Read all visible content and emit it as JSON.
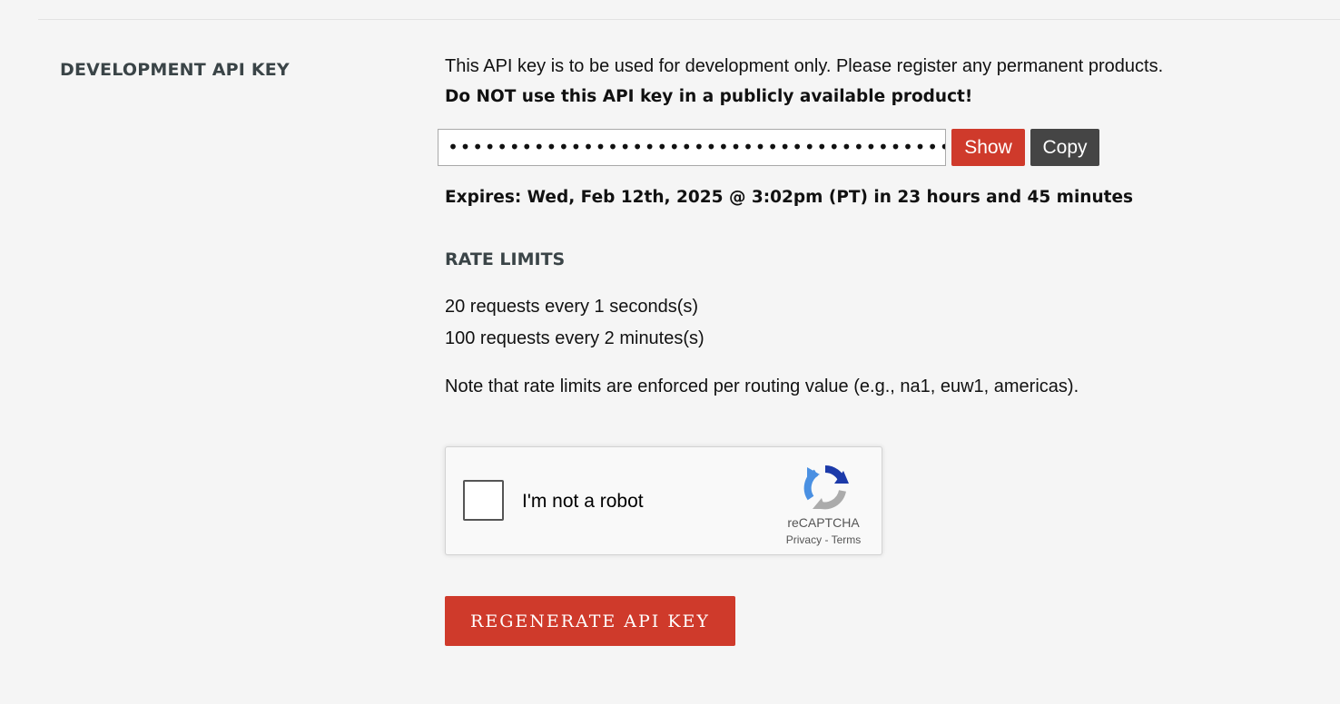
{
  "section": {
    "label": "DEVELOPMENT API KEY"
  },
  "api_key": {
    "description": "This API key is to be used for development only. Please register any permanent products.",
    "warning": "Do NOT use this API key in a publicly available product!",
    "masked_value": "••••••••••••••••••••••••••••••••••••••••••",
    "show_label": "Show",
    "copy_label": "Copy",
    "expires": "Expires: Wed, Feb 12th, 2025 @ 3:02pm (PT) in 23 hours and 45 minutes"
  },
  "rate_limits": {
    "heading": "RATE LIMITS",
    "lines": [
      "20 requests every 1 seconds(s)",
      "100 requests every 2 minutes(s)"
    ],
    "note": "Note that rate limits are enforced per routing value (e.g., na1, euw1, americas)."
  },
  "captcha": {
    "label": "I'm not a robot",
    "brand": "reCAPTCHA",
    "privacy": "Privacy",
    "separator": " - ",
    "terms": "Terms",
    "icon": "recaptcha-logo-icon"
  },
  "actions": {
    "regenerate_label": "REGENERATE API KEY"
  },
  "colors": {
    "accent_red": "#cf3a2b",
    "dark_button": "#454545",
    "heading": "#3a4447",
    "background": "#f5f5f5"
  }
}
